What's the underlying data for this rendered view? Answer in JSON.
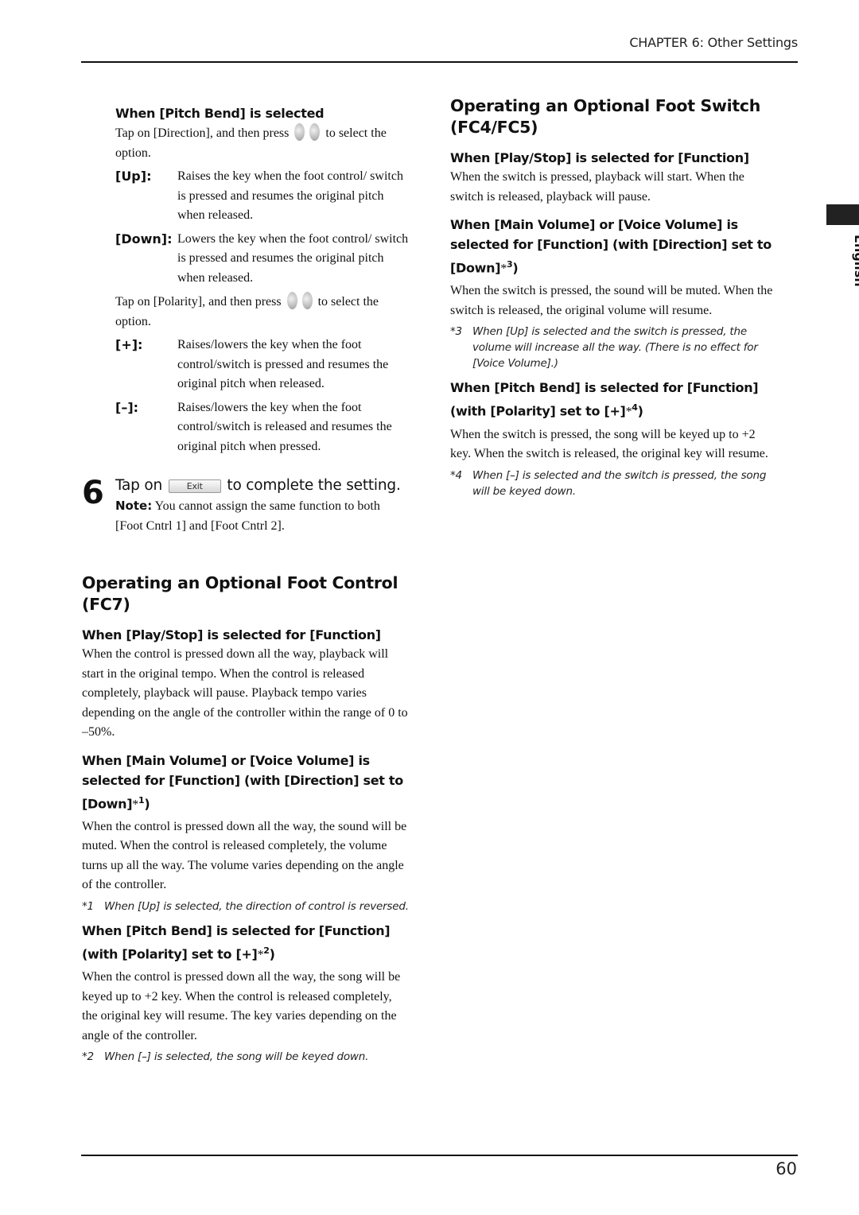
{
  "header": {
    "chapter": "CHAPTER 6: Other Settings"
  },
  "language_tab": {
    "label": "English"
  },
  "page_number": "60",
  "left": {
    "pitch_bend": {
      "heading": "When [Pitch Bend] is selected",
      "direction_intro_a": "Tap on [Direction], and then press",
      "direction_intro_b": "to select the option.",
      "direction_options": [
        {
          "term": "[Up]:",
          "desc": "Raises the key when the foot control/ switch is pressed and resumes the original pitch when released."
        },
        {
          "term": "[Down]:",
          "desc": "Lowers the key when the foot control/ switch is pressed and resumes the original pitch when released."
        }
      ],
      "polarity_intro_a": "Tap on [Polarity], and then press",
      "polarity_intro_b": "to select the option.",
      "polarity_options": [
        {
          "term": "[+]:",
          "desc": "Raises/lowers the key when the foot control/switch is pressed and resumes the original pitch when released."
        },
        {
          "term": "[–]:",
          "desc": "Raises/lowers the key when the foot control/switch is released and resumes the original pitch when pressed."
        }
      ]
    },
    "step6": {
      "number": "6",
      "title_a": "Tap on",
      "button_label": "Exit",
      "title_b": "to complete the setting.",
      "note_label": "Note:",
      "note_text": "You cannot assign the same function to both [Foot Cntrl 1] and [Foot Cntrl 2]."
    },
    "fc7": {
      "title": "Operating an Optional Foot Control (FC7)",
      "play_stop_heading": "When [Play/Stop] is selected for [Function]",
      "play_stop_text": "When the control is pressed down all the way, playback will start in the original tempo. When the control is released completely, playback will pause. Playback tempo varies depending on the angle of the controller within the range of 0 to –50%.",
      "volume_heading": "When [Main Volume] or [Voice Volume] is selected for [Function] (with [Direction] set to [Down]",
      "volume_mark": "1",
      "volume_text": "When the control is pressed down all the way, the sound will be muted. When the control is released completely, the volume turns up all the way. The volume varies depending on the angle of the controller.",
      "footnote1_mark": "*1",
      "footnote1_text": "When [Up] is selected, the direction of control is reversed.",
      "pitch_heading": "When [Pitch Bend] is selected for [Function] (with [Polarity] set to [+]",
      "pitch_mark": "2",
      "pitch_text": "When the control is pressed down all the way, the song will be keyed up to +2 key. When the control is released completely, the original key will resume. The key varies depending on the angle of the controller.",
      "footnote2_mark": "*2",
      "footnote2_text": "When [–] is selected, the song will be keyed down."
    }
  },
  "right": {
    "fc4": {
      "title": "Operating an Optional Foot Switch (FC4/FC5)",
      "play_stop_heading": "When [Play/Stop] is selected for [Function]",
      "play_stop_text": "When the switch is pressed, playback will start. When the switch is released, playback will pause.",
      "volume_heading": "When [Main Volume] or [Voice Volume] is selected for [Function] (with [Direction] set to [Down]",
      "volume_mark": "3",
      "volume_text": "When the switch is pressed, the sound will be muted. When the switch is released, the original volume will resume.",
      "footnote3_mark": "*3",
      "footnote3_text": "When [Up] is selected and the switch is pressed, the volume will increase all the way. (There is no effect for [Voice Volume].)",
      "pitch_heading": "When [Pitch Bend] is selected for [Function] (with [Polarity] set to [+]",
      "pitch_mark": "4",
      "pitch_text": "When the switch is pressed, the song will be keyed up to +2 key. When the switch is released, the original key will resume.",
      "footnote4_mark": "*4",
      "footnote4_text": "When [–] is selected and the switch is pressed, the song will be keyed down."
    }
  }
}
